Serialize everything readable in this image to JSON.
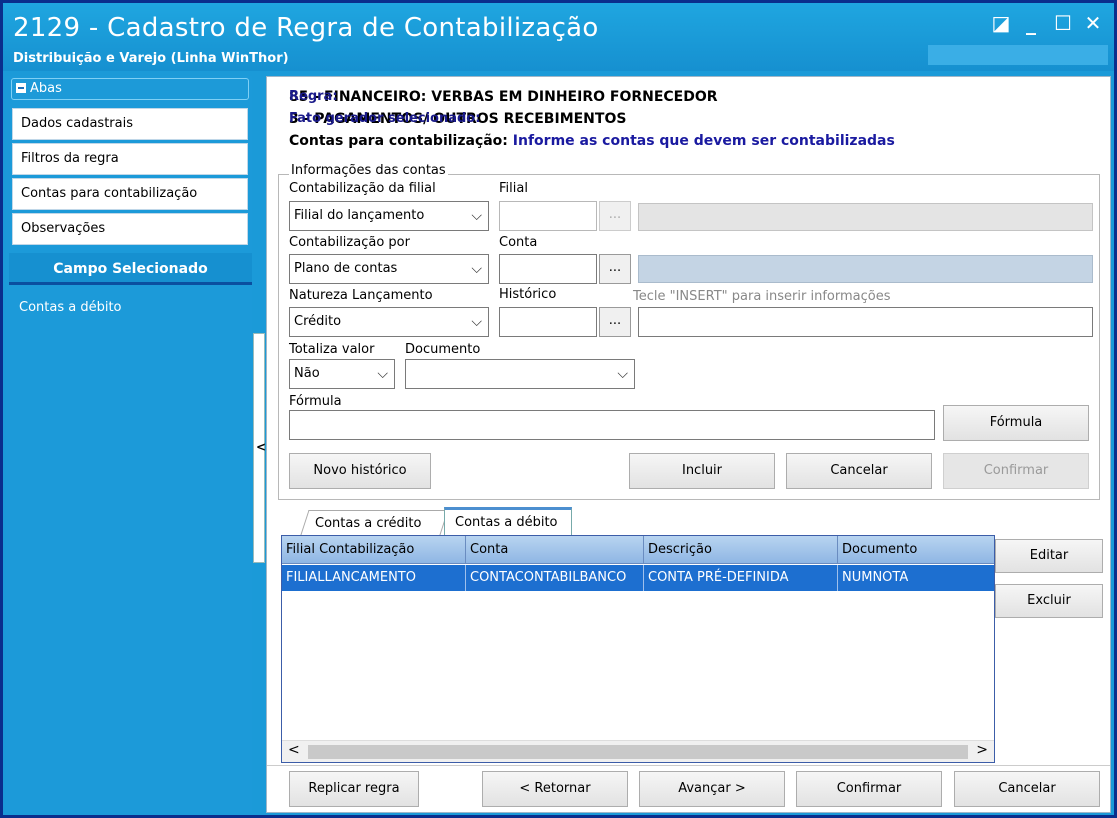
{
  "window": {
    "title": "2129 - Cadastro de Regra de Contabilização",
    "subtitle": "Distribuição e Varejo (Linha WinThor)",
    "controls": [
      "◪",
      "_",
      "☐",
      "✕"
    ]
  },
  "sidebar": {
    "abas_label": "Abas",
    "items": [
      {
        "label": "Dados cadastrais"
      },
      {
        "label": "Filtros da regra"
      },
      {
        "label": "Contas para contabilização"
      },
      {
        "label": "Observações"
      }
    ],
    "campo_header": "Campo Selecionado",
    "campo_value": "Contas a débito"
  },
  "info": {
    "regra_label": "Regra:",
    "regra_value": "85 - FINANCEIRO: VERBAS EM DINHEIRO FORNECEDOR",
    "fato_label": "Fato gerador selecionado:",
    "fato_value": "3 - PAGAMENTOS/ OUTROS RECEBIMENTOS",
    "contas_label": "Contas para contabilização:",
    "contas_value": "Informe as contas que devem ser contabilizadas"
  },
  "form": {
    "group_title": "Informações das contas",
    "contab_filial_label": "Contabilização da filial",
    "contab_filial_value": "Filial do lançamento",
    "filial_label": "Filial",
    "contab_por_label": "Contabilização por",
    "contab_por_value": "Plano de contas",
    "conta_label": "Conta",
    "natureza_label": "Natureza Lançamento",
    "natureza_value": "Crédito",
    "historico_label": "Histórico",
    "insert_hint": "Tecle  \"INSERT\" para inserir informações",
    "totaliza_label": "Totaliza valor",
    "totaliza_value": "Não",
    "documento_label": "Documento",
    "documento_value": "",
    "formula_label": "Fórmula",
    "ellipsis": "...",
    "chevron": "⌵"
  },
  "buttons": {
    "formula": "Fórmula",
    "novo_historico": "Novo histórico",
    "incluir": "Incluir",
    "cancelar": "Cancelar",
    "confirmar": "Confirmar",
    "editar": "Editar",
    "excluir": "Excluir",
    "replicar": "Replicar regra",
    "retornar": "< Retornar",
    "avancar": "Avançar >",
    "confirmar_bottom": "Confirmar",
    "cancelar_bottom": "Cancelar"
  },
  "tabs": [
    {
      "label": "Contas a crédito",
      "active": false
    },
    {
      "label": "Contas a débito",
      "active": true
    }
  ],
  "grid": {
    "columns": [
      "Filial Contabilização",
      "Conta",
      "Descrição",
      "Documento"
    ],
    "rows": [
      [
        "FILIALLANCAMENTO",
        "CONTACONTABILBANCO",
        "CONTA PRÉ-DEFINIDA",
        "NUMNOTA"
      ]
    ],
    "scroll_left": "<",
    "scroll_right": ">"
  },
  "colors": {
    "title_bg": "#1ba0dc",
    "selected_row": "#1d6fd0",
    "info_label": "#1a1a8a"
  },
  "collapse_arrow": "<"
}
